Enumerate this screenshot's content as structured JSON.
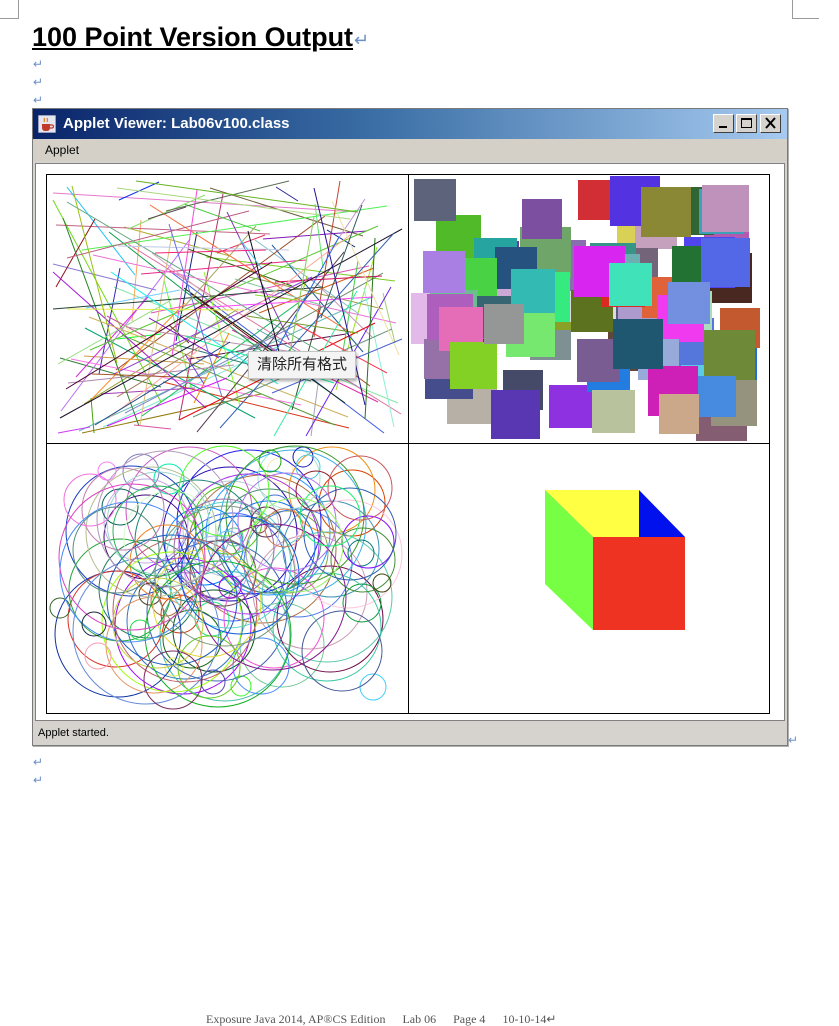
{
  "document": {
    "heading": "100 Point Version Output",
    "paragraph_mark": "↵",
    "footer": {
      "book": "Exposure Java 2014, AP®CS Edition",
      "lab": "Lab 06",
      "page": "Page 4",
      "date": "10-10-14↵"
    }
  },
  "window": {
    "title": "Applet Viewer: Lab06v100.class",
    "menu": [
      "Applet"
    ],
    "status": "Applet started.",
    "controls": [
      "minimize",
      "maximize",
      "close"
    ],
    "colors": {
      "titlebar_start": "#0a246a",
      "titlebar_end": "#a6caf0",
      "chrome": "#d6d3ce"
    }
  },
  "applet": {
    "tooltip": "清除所有格式",
    "panels": [
      {
        "content": "random-lines"
      },
      {
        "content": "random-squares"
      },
      {
        "content": "random-circles"
      },
      {
        "content": "cube",
        "cube_colors": {
          "top": "#ffff44",
          "left": "#77ff44",
          "front": "#ee3322",
          "back": "#0011ee"
        }
      }
    ]
  }
}
